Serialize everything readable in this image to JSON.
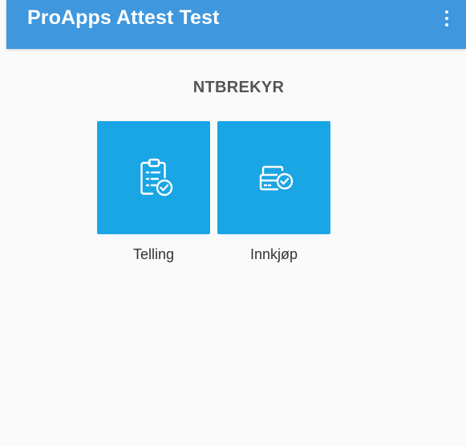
{
  "app_bar": {
    "title": "ProApps Attest Test",
    "menu_icon": "more-vertical-icon",
    "background_color": "#3f97dd"
  },
  "main": {
    "company_name": "NTBREKYR",
    "tile_color": "#1aa5e4",
    "tiles": [
      {
        "label": "Telling",
        "icon": "clipboard-check-icon"
      },
      {
        "label": "Innkjøp",
        "icon": "card-check-icon"
      }
    ]
  }
}
